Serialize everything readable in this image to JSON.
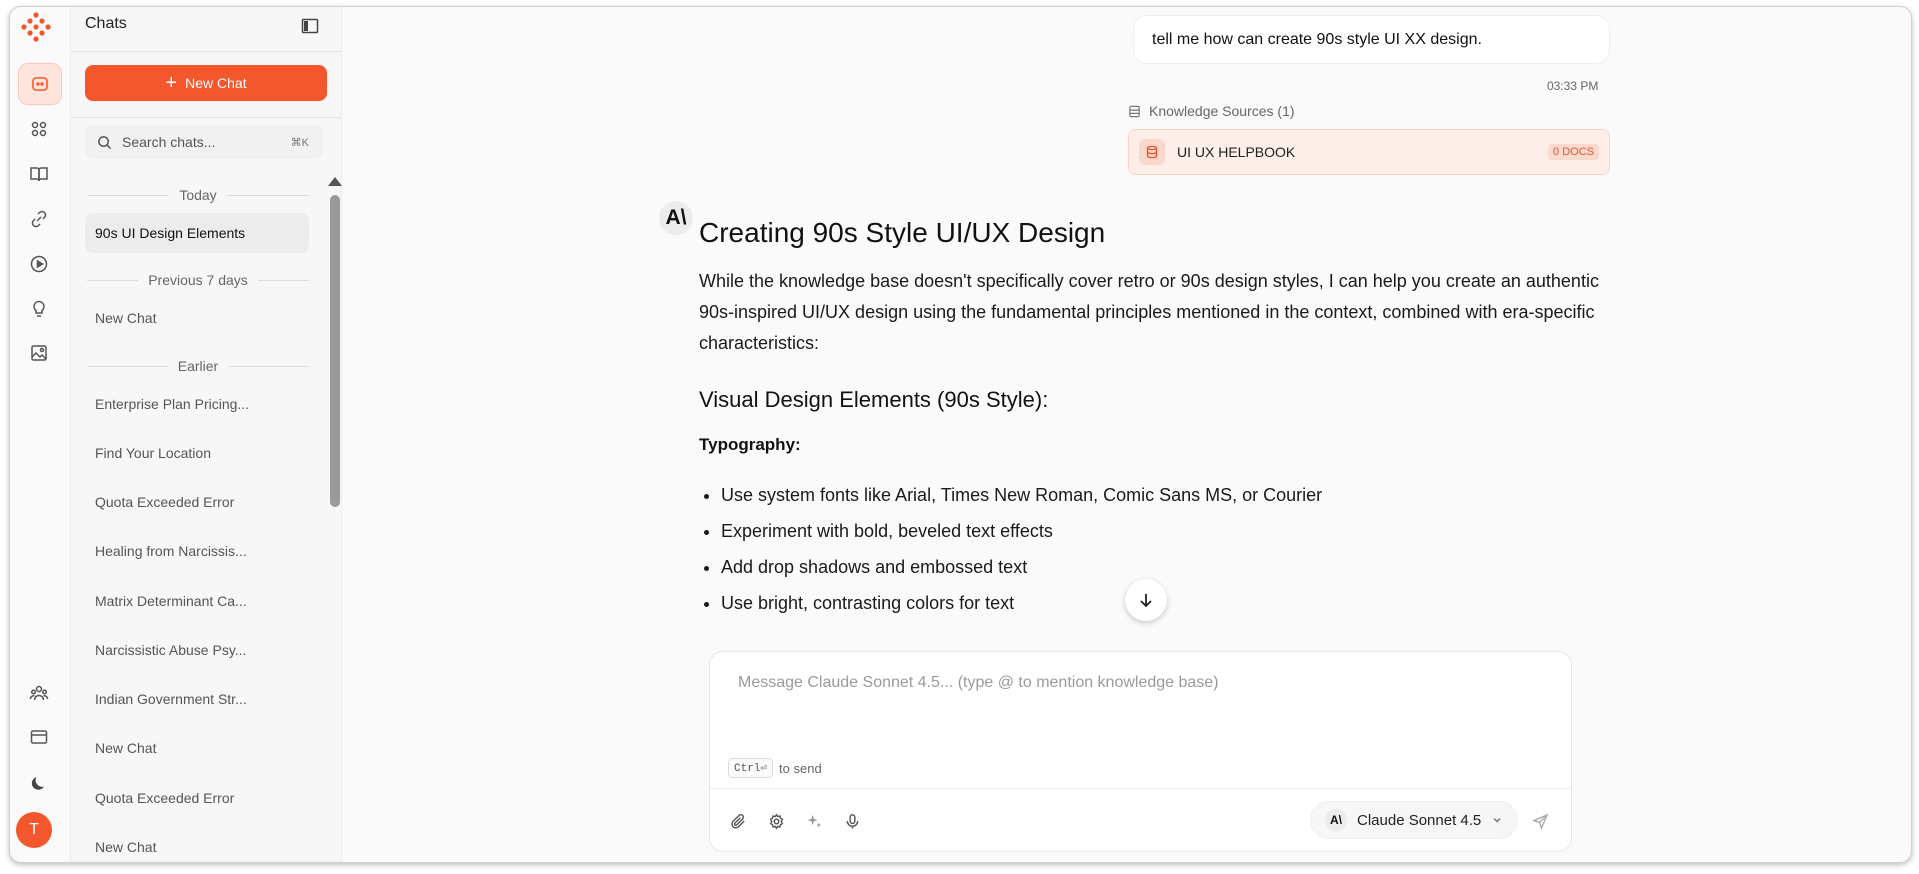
{
  "colors": {
    "accent": "#f4572b",
    "accent_soft": "#fde4dc",
    "badge_text": "#e4572e"
  },
  "rail": {
    "icons": [
      "bot-icon",
      "grid-icon",
      "book-icon",
      "link-icon",
      "play-icon",
      "lightbulb-icon",
      "image-icon",
      "users-icon",
      "card-icon",
      "moon-icon"
    ],
    "avatar_initial": "T"
  },
  "sidebar": {
    "title": "Chats",
    "new_chat_label": "New Chat",
    "search_placeholder": "Search chats...",
    "search_shortcut": "⌘K",
    "groups": {
      "today": "Today",
      "prev7": "Previous 7 days",
      "earlier": "Earlier"
    },
    "today_items": [
      "90s UI Design Elements"
    ],
    "prev7_items": [
      "New Chat"
    ],
    "earlier_items": [
      "Enterprise Plan Pricing...",
      "Find Your Location",
      "Quota Exceeded Error",
      "Healing from Narcissis...",
      "Matrix Determinant Ca...",
      "Narcissistic Abuse Psy...",
      "Indian Government Str...",
      "New Chat",
      "Quota Exceeded Error",
      "New Chat"
    ]
  },
  "conversation": {
    "user_message": "tell me how can create 90s style UI XX design.",
    "timestamp": "03:33 PM",
    "knowledge_sources_label": "Knowledge Sources (1)",
    "knowledge_source": {
      "name": "UI UX HELPBOOK",
      "badge": "0 DOCS"
    },
    "bot_avatar": "A\\",
    "answer": {
      "title": "Creating 90s Style UI/UX Design",
      "intro": "While the knowledge base doesn't specifically cover retro or 90s design styles, I can help you create an authentic 90s-inspired UI/UX design using the fundamental principles mentioned in the context, combined with era-specific characteristics:",
      "section": "Visual Design Elements (90s Style):",
      "subsection": "Typography:",
      "bullets": [
        "Use system fonts like Arial, Times New Roman, Comic Sans MS, or Courier",
        "Experiment with bold, beveled text effects",
        "Add drop shadows and embossed text",
        "Use bright, contrasting colors for text"
      ]
    }
  },
  "composer": {
    "placeholder": "Message Claude Sonnet 4.5... (type @ to mention knowledge base)",
    "hint_key": "Ctrl⏎",
    "hint_text": "to send",
    "model_logo": "A\\",
    "model_name": "Claude Sonnet 4.5"
  }
}
